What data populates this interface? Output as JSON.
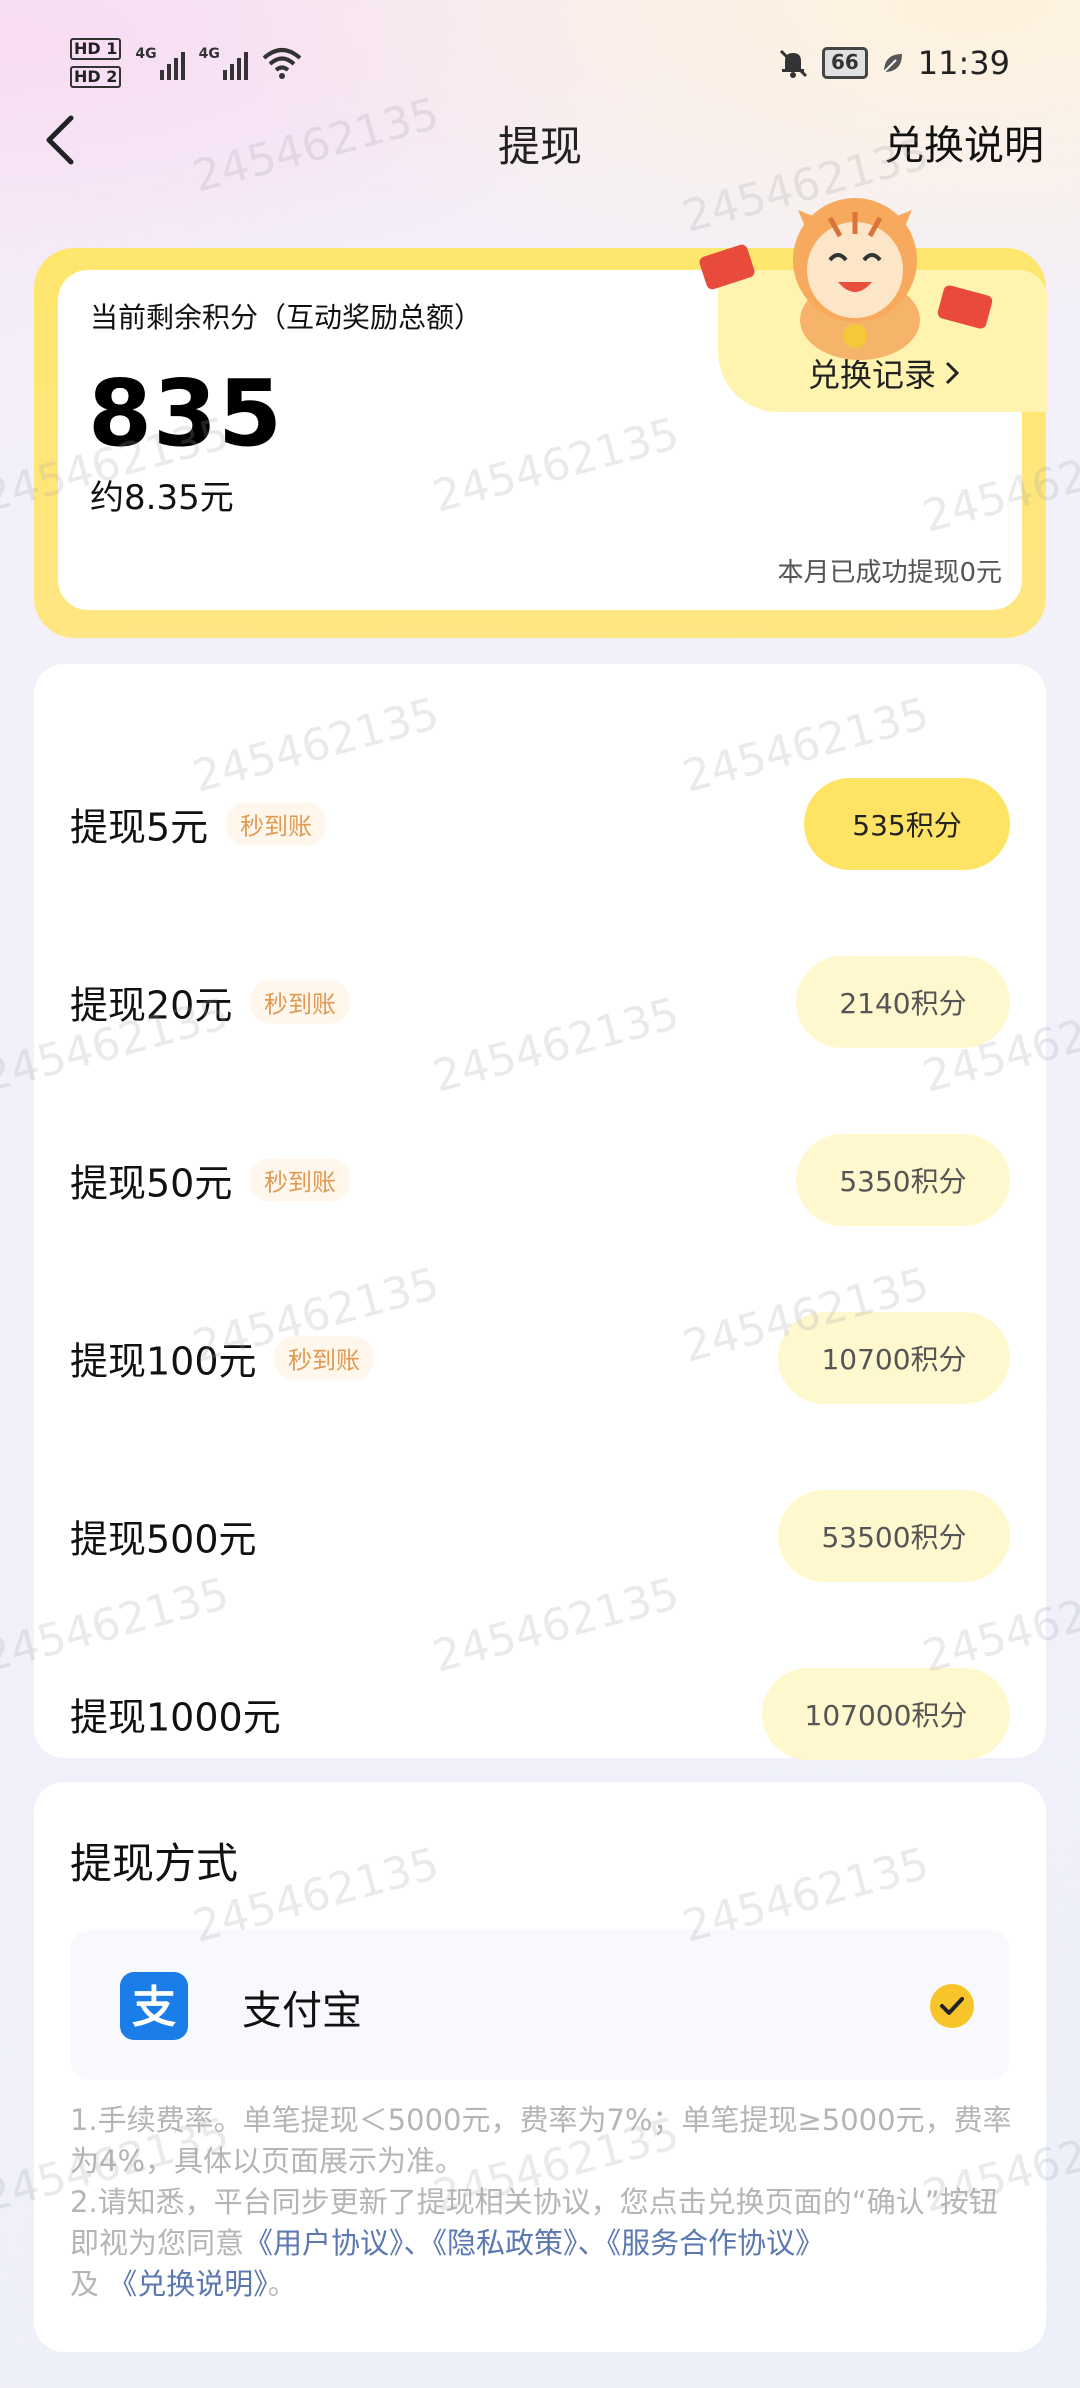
{
  "status_bar": {
    "hd1": "HD 1",
    "hd2": "HD 2",
    "sig1_label": "4G",
    "sig2_label": "4G",
    "battery": "66",
    "time": "11:39"
  },
  "header": {
    "title": "提现",
    "explain_label": "兑换说明"
  },
  "balance": {
    "label": "当前剩余积分（互动奖励总额）",
    "points": "835",
    "yuan": "约8.35元",
    "record_label": "兑换记录",
    "month_status": "本月已成功提现0元"
  },
  "options": [
    {
      "name": "提现5元",
      "badge": "秒到账",
      "cost": "535积分",
      "active": true
    },
    {
      "name": "提现20元",
      "badge": "秒到账",
      "cost": "2140积分",
      "active": false
    },
    {
      "name": "提现50元",
      "badge": "秒到账",
      "cost": "5350积分",
      "active": false
    },
    {
      "name": "提现100元",
      "badge": "秒到账",
      "cost": "10700积分",
      "active": false
    },
    {
      "name": "提现500元",
      "badge": "",
      "cost": "53500积分",
      "active": false
    },
    {
      "name": "提现1000元",
      "badge": "",
      "cost": "107000积分",
      "active": false
    }
  ],
  "method": {
    "title": "提现方式",
    "option_label": "支付宝",
    "logo_char": "支"
  },
  "notes": {
    "line1": "1.手续费率。单笔提现＜5000元，费率为7%；单笔提现≥5000元，费率为4%，具体以页面展示为准。",
    "line2_prefix": "2.请知悉，平台同步更新了提现相关协议，您点击兑换页面的“确认”按钮即视为您同意",
    "link_user": "《用户协议》",
    "sep1": "、",
    "link_privacy": "《隐私政策》",
    "sep2": "、",
    "link_service": "《服务合作协议》",
    "and_text": "及 ",
    "link_exchange": "《兑换说明》",
    "end": "。"
  },
  "watermark": "245462135",
  "colors": {
    "accent_yellow": "#ffe365",
    "pale_yellow": "#fff8cf",
    "badge_orange": "#e09a52",
    "link_blue": "#5c78b0",
    "alipay_blue": "#1a7de8"
  }
}
